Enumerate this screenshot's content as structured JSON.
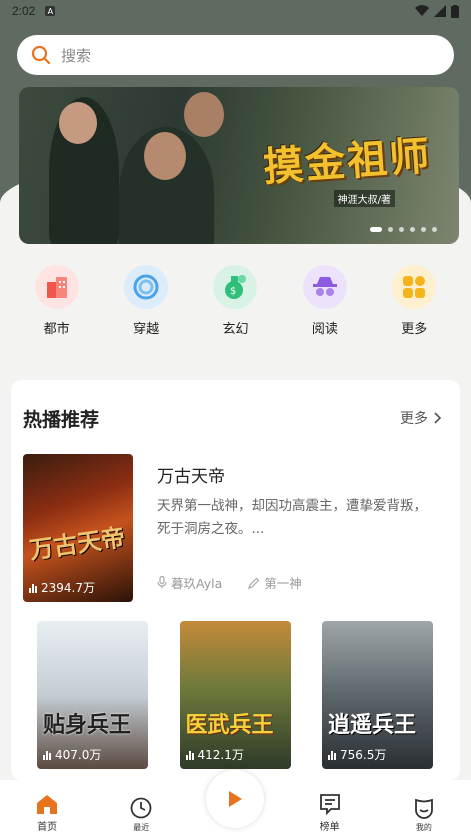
{
  "status_bar": {
    "time": "2:02",
    "notif_icon": "A"
  },
  "search": {
    "placeholder": "搜索"
  },
  "banner": {
    "title": "摸金祖师",
    "author": "神涯大叔/著",
    "dot_count": 6,
    "active_dot": 0
  },
  "categories": [
    {
      "label": "都市",
      "icon": "city-icon",
      "color": "#f0564b"
    },
    {
      "label": "穿越",
      "icon": "swirl-icon",
      "color": "#4aa3e8"
    },
    {
      "label": "玄幻",
      "icon": "potion-icon",
      "color": "#2fbf7b"
    },
    {
      "label": "阅读",
      "icon": "incognito-icon",
      "color": "#8d5be0"
    },
    {
      "label": "更多",
      "icon": "grid-icon",
      "color": "#f5b31c"
    }
  ],
  "hot_section": {
    "title": "热播推荐",
    "more_label": "更多",
    "featured": {
      "title": "万古天帝",
      "cover_text": "万古天帝",
      "description": "天界第一战神，却因功高震主，遭挚爱背叛，死于洞房之夜。...",
      "narrator": "暮玖Ayla",
      "author": "第一神",
      "play_count": "2394.7万"
    },
    "grid": [
      {
        "cover_text": "贴身兵王",
        "play_count": "407.0万"
      },
      {
        "cover_text": "医武兵王",
        "play_count": "412.1万"
      },
      {
        "cover_text": "逍遥兵王",
        "play_count": "756.5万"
      }
    ]
  },
  "tabbar": {
    "home": "首页",
    "recent": "最近",
    "ranking": "榜单",
    "mine": "我的",
    "accent": "#e8731f"
  }
}
